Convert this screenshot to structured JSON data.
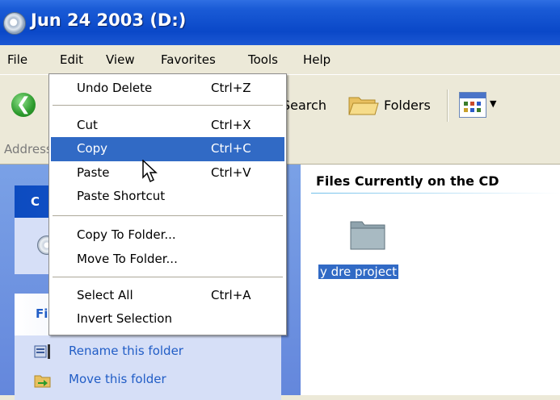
{
  "window": {
    "title": "Jun 24 2003 (D:)"
  },
  "menubar": {
    "items": [
      "File",
      "Edit",
      "View",
      "Favorites",
      "Tools",
      "Help"
    ]
  },
  "toolbar": {
    "search_label": "Search",
    "folders_label": "Folders"
  },
  "address": {
    "label": "Address"
  },
  "edit_menu": {
    "items": [
      {
        "label": "Undo Delete",
        "shortcut": "Ctrl+Z"
      },
      {
        "label": "Cut",
        "shortcut": "Ctrl+X"
      },
      {
        "label": "Copy",
        "shortcut": "Ctrl+C"
      },
      {
        "label": "Paste",
        "shortcut": "Ctrl+V"
      },
      {
        "label": "Paste Shortcut",
        "shortcut": ""
      },
      {
        "label": "Copy To Folder...",
        "shortcut": ""
      },
      {
        "label": "Move To Folder...",
        "shortcut": ""
      },
      {
        "label": "Select All",
        "shortcut": "Ctrl+A"
      },
      {
        "label": "Invert Selection",
        "shortcut": ""
      }
    ],
    "highlighted": "Copy"
  },
  "left_pane": {
    "panel1_title": "C",
    "panel2_title": "Fi",
    "tasks": [
      "Rename this folder",
      "Move this folder"
    ]
  },
  "right_pane": {
    "heading": "Files Currently on the CD",
    "folder_label": "y dre project"
  },
  "colors": {
    "selection": "#316ac5",
    "titlebar": "#0a48c8",
    "task_link": "#215dc6"
  },
  "icons": [
    "drive-icon",
    "back-icon",
    "folders-icon",
    "views-icon",
    "folder-icon",
    "rename-icon",
    "move-icon",
    "cursor-icon"
  ]
}
